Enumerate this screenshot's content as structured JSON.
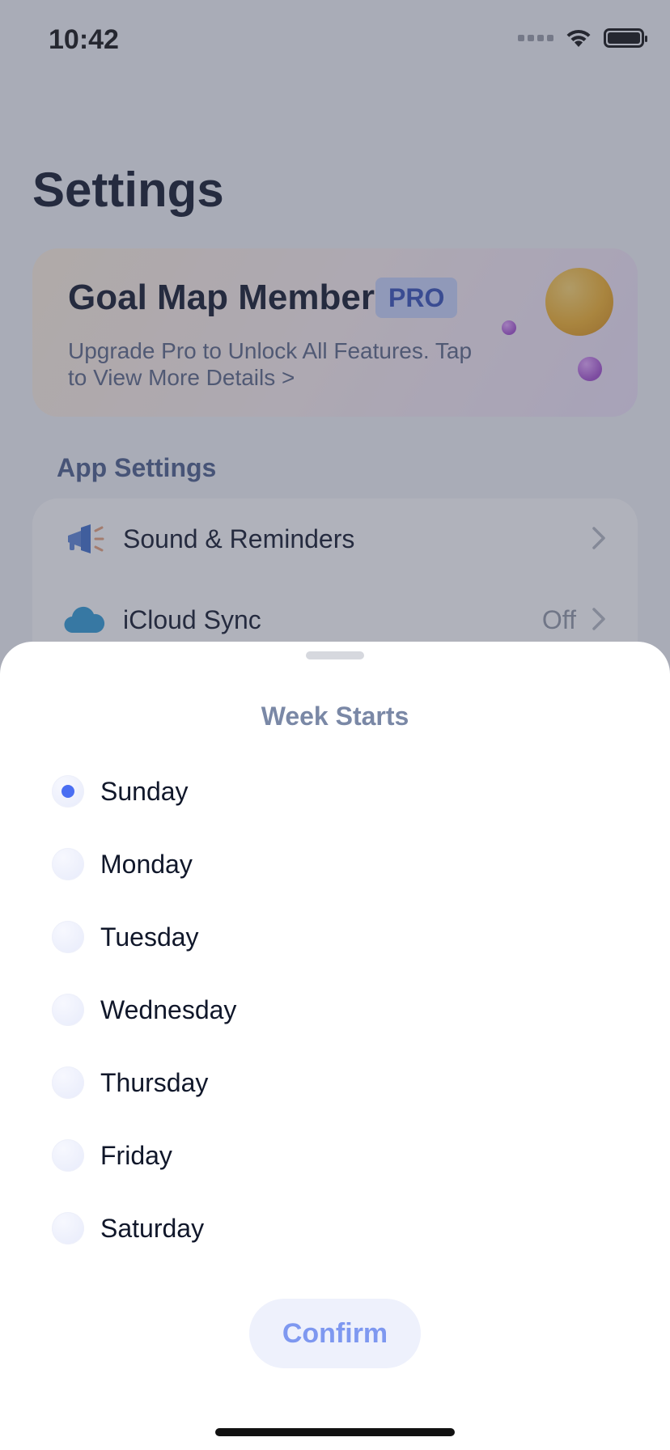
{
  "status_bar": {
    "time": "10:42"
  },
  "page": {
    "title": "Settings"
  },
  "pro_card": {
    "title": "Goal Map Member",
    "badge": "PRO",
    "description": "Upgrade Pro to Unlock All Features. Tap to View More Details",
    "chevron": ">"
  },
  "app_settings": {
    "section_label": "App Settings",
    "items": [
      {
        "label": "Sound & Reminders",
        "value": "",
        "icon": "megaphone-icon"
      },
      {
        "label": "iCloud Sync",
        "value": "Off",
        "icon": "cloud-icon"
      }
    ]
  },
  "sheet": {
    "title": "Week Starts",
    "selected": "Sunday",
    "options": [
      {
        "label": "Sunday",
        "selected": true
      },
      {
        "label": "Monday",
        "selected": false
      },
      {
        "label": "Tuesday",
        "selected": false
      },
      {
        "label": "Wednesday",
        "selected": false
      },
      {
        "label": "Thursday",
        "selected": false
      },
      {
        "label": "Friday",
        "selected": false
      },
      {
        "label": "Saturday",
        "selected": false
      }
    ],
    "confirm_label": "Confirm"
  },
  "colors": {
    "accent": "#4a6ef2",
    "confirm_text": "#7e98f0",
    "confirm_bg": "#eef1fc",
    "pro_badge_bg": "#c9d4fb"
  }
}
